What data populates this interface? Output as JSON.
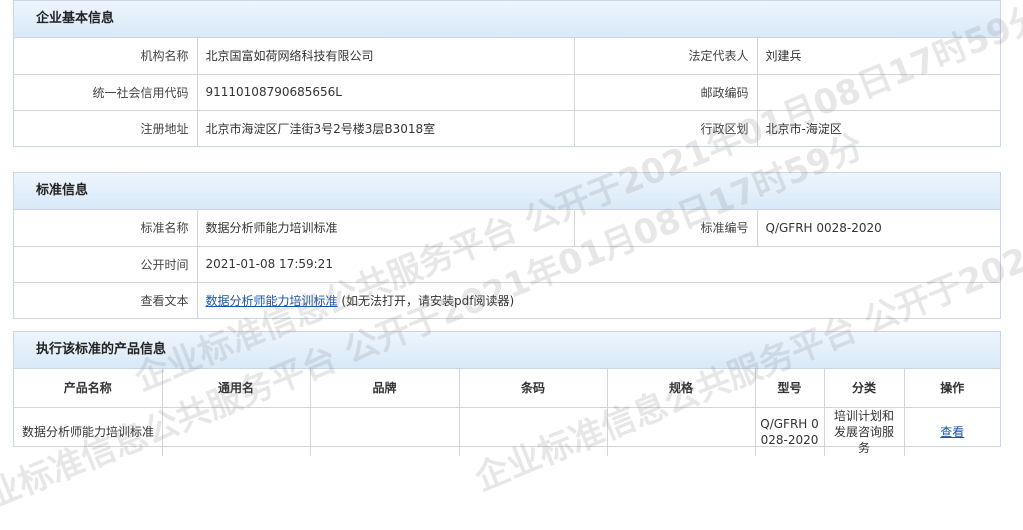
{
  "company": {
    "title": "企业基本信息",
    "org_name_label": "机构名称",
    "org_name": "北京国富如荷网络科技有限公司",
    "legal_rep_label": "法定代表人",
    "legal_rep": "刘建兵",
    "credit_code_label": "统一社会信用代码",
    "credit_code": "91110108790685656L",
    "postal_label": "邮政编码",
    "postal": "",
    "address_label": "注册地址",
    "address": "北京市海淀区厂洼街3号2号楼3层B3018室",
    "region_label": "行政区划",
    "region": "北京市-海淀区"
  },
  "standard": {
    "title": "标准信息",
    "name_label": "标准名称",
    "name": "数据分析师能力培训标准",
    "number_label": "标准编号",
    "number": "Q/GFRH 0028-2020",
    "time_label": "公开时间",
    "time": "2021-01-08 17:59:21",
    "view_label": "查看文本",
    "view_link": "数据分析师能力培训标准",
    "view_note": "(如无法打开，请安装pdf阅读器)"
  },
  "products": {
    "title": "执行该标准的产品信息",
    "columns": [
      "产品名称",
      "通用名",
      "品牌",
      "条码",
      "规格",
      "型号",
      "分类",
      "操作"
    ],
    "rows": [
      {
        "name": "数据分析师能力培训标准",
        "generic": "",
        "brand": "",
        "barcode": "",
        "spec": "",
        "model": "Q/GFRH 0028-2020",
        "category": "培训计划和发展咨询服务",
        "action": "查看"
      }
    ]
  },
  "watermark": {
    "text": "企业标准信息公共服务平台 公开于2021年01月08日17时59分"
  }
}
